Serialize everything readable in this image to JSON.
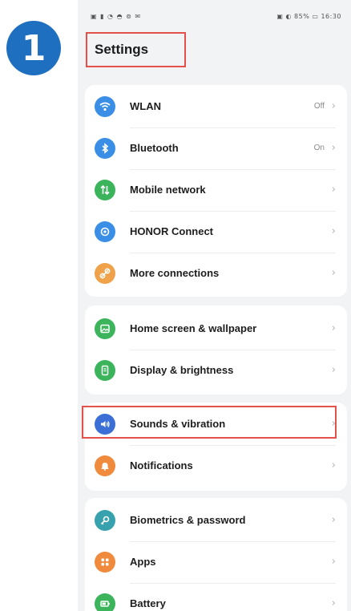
{
  "step_number": "1",
  "statusbar": {
    "left": "▣ ▮ ◔ ◓ ⊚ ✉",
    "right": "▣ ◐ 85% ▭ 16:30"
  },
  "screen_title": "Settings",
  "groups": [
    {
      "items": [
        {
          "label": "WLAN",
          "value": "Off",
          "icon": "wifi-icon",
          "color": "#3a8ee6"
        },
        {
          "label": "Bluetooth",
          "value": "On",
          "icon": "bluetooth-icon",
          "color": "#3a8ee6"
        },
        {
          "label": "Mobile network",
          "value": "",
          "icon": "mobile-network-icon",
          "color": "#3bb45c"
        },
        {
          "label": "HONOR Connect",
          "value": "",
          "icon": "honor-connect-icon",
          "color": "#3a8ee6"
        },
        {
          "label": "More connections",
          "value": "",
          "icon": "link-icon",
          "color": "#f0a24a"
        }
      ]
    },
    {
      "items": [
        {
          "label": "Home screen & wallpaper",
          "value": "",
          "icon": "wallpaper-icon",
          "color": "#3bb45c"
        },
        {
          "label": "Display & brightness",
          "value": "",
          "icon": "display-icon",
          "color": "#3bb45c"
        }
      ]
    },
    {
      "items": [
        {
          "label": "Sounds & vibration",
          "value": "",
          "icon": "speaker-icon",
          "color": "#3c6fd6"
        },
        {
          "label": "Notifications",
          "value": "",
          "icon": "bell-icon",
          "color": "#f08a3c"
        }
      ]
    },
    {
      "items": [
        {
          "label": "Biometrics & password",
          "value": "",
          "icon": "key-icon",
          "color": "#37a2ad"
        },
        {
          "label": "Apps",
          "value": "",
          "icon": "apps-icon",
          "color": "#f08a3c"
        },
        {
          "label": "Battery",
          "value": "",
          "icon": "battery-icon",
          "color": "#3bb45c"
        }
      ]
    }
  ],
  "colors": {
    "highlight_border": "#e4504a",
    "step_badge": "#1e6fc0",
    "background": "#f1f3f5"
  }
}
